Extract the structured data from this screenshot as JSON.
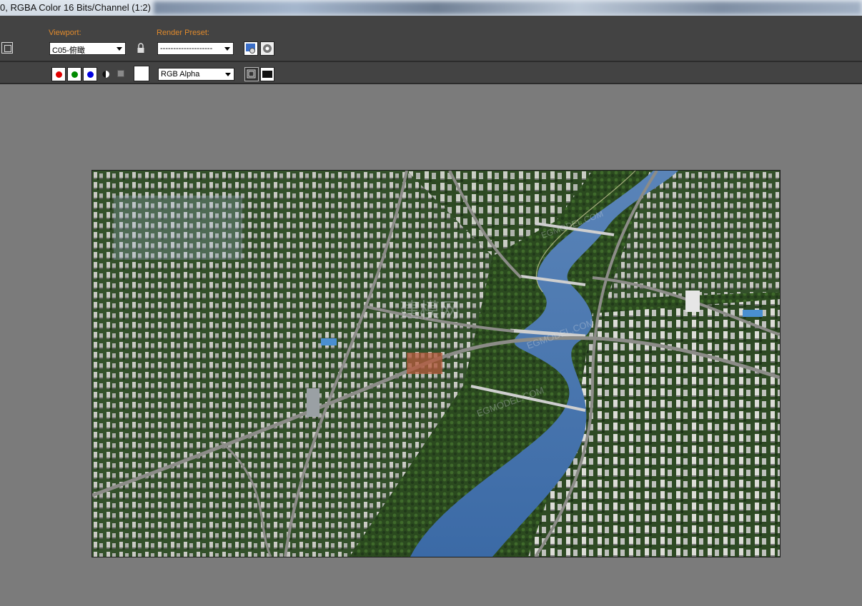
{
  "window": {
    "title": "0, RGBA Color 16 Bits/Channel (1:2)"
  },
  "toolbar": {
    "viewport_label": "Viewport:",
    "viewport_value": "C05-俯瞰",
    "render_preset_label": "Render Preset:",
    "render_preset_value": "--------------------",
    "channel_value": "RGB Alpha",
    "icons": {
      "frame": "frame-icon",
      "lock": "lock-icon",
      "render_setup": "render-setup-icon",
      "environment": "environment-icon",
      "mono": "monochrome-icon",
      "clear": "clear-icon",
      "color_swatch": "color-swatch",
      "display_alpha": "display-alpha-icon",
      "display_mono": "display-mono-icon"
    },
    "channel_buttons": [
      {
        "name": "red-channel-button",
        "color": "#e00000"
      },
      {
        "name": "green-channel-button",
        "color": "#008a00"
      },
      {
        "name": "blue-channel-button",
        "color": "#0000e0"
      }
    ]
  },
  "render": {
    "watermarks": [
      "EGMODEL.COM",
      "EGMODEL.COM",
      "EGMODEL.COM"
    ]
  },
  "colors": {
    "toolbar_bg": "#434343",
    "label_orange": "#e08a2c",
    "viewport_bg": "#7b7b7b",
    "river": "#3f6fa8",
    "vegetation": "#2f4d22"
  }
}
